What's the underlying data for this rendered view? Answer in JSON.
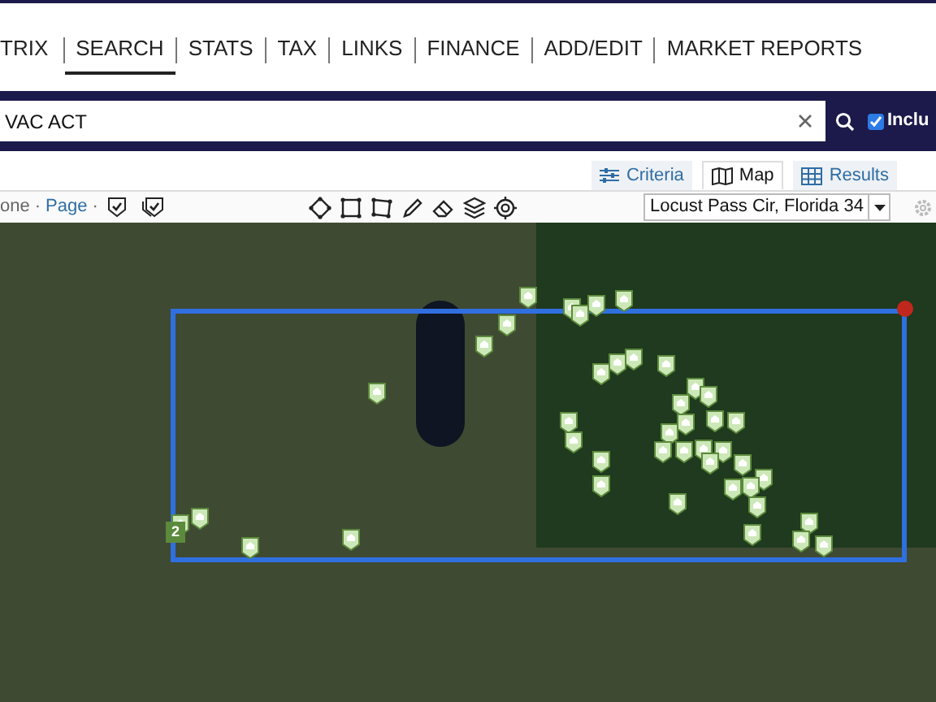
{
  "nav_tabs": [
    {
      "label": "TRIX",
      "selected": false
    },
    {
      "label": "SEARCH",
      "selected": true
    },
    {
      "label": "STATS",
      "selected": false
    },
    {
      "label": "TAX",
      "selected": false
    },
    {
      "label": "LINKS",
      "selected": false
    },
    {
      "label": "FINANCE",
      "selected": false
    },
    {
      "label": "ADD/EDIT",
      "selected": false
    },
    {
      "label": "MARKET REPORTS",
      "selected": false
    }
  ],
  "search": {
    "value": "VAC ACT",
    "include_checkbox": {
      "label": "Inclu",
      "checked": true
    }
  },
  "view_tabs": [
    {
      "label": "Criteria",
      "kind": "criteria",
      "selected": false
    },
    {
      "label": "Map",
      "kind": "map",
      "selected": true
    },
    {
      "label": "Results",
      "kind": "results",
      "selected": false
    }
  ],
  "toolbar": {
    "links": [
      "one",
      "Page"
    ],
    "separator": "·",
    "location": "Locust Pass Cir, Florida 34"
  },
  "map": {
    "cluster_count": "2"
  }
}
